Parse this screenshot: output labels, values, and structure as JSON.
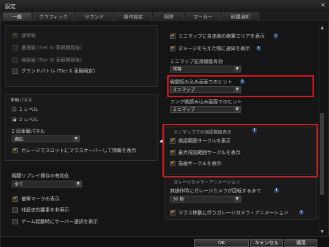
{
  "window": {
    "title": "設定",
    "close_icon": "×"
  },
  "tabs": [
    {
      "label": "一般"
    },
    {
      "label": "グラフィック"
    },
    {
      "label": "サウンド"
    },
    {
      "label": "操作設定"
    },
    {
      "label": "照準"
    },
    {
      "label": "マーカー"
    },
    {
      "label": "戦闘通知"
    }
  ],
  "left": {
    "battle_modes": [
      {
        "label": "通常戦",
        "checked": true,
        "disabled": true
      },
      {
        "label": "遭遇戦 (Tier IV 車輌開発後)",
        "checked": false,
        "disabled": true
      },
      {
        "label": "強襲戦 (Tier VI 車輌開発後)",
        "checked": false,
        "disabled": true
      },
      {
        "label": "グランドバトル (Tier X 車輌限定)",
        "checked": false,
        "disabled": false
      }
    ],
    "vehicle_panel": {
      "header": "車輌パネル",
      "radio1": "1 レベル",
      "radio2": "2 レベル",
      "two_level_label": "2 段車輌パネル",
      "two_level_value": "適応",
      "garage_slot": "ガレージでスロットにマウスオーバーして情報を表示"
    },
    "replay": {
      "label": "戦闘リプレイ保存の有効化",
      "value": "全て"
    },
    "misc": [
      {
        "label": "優等マークの表示",
        "checked": true
      },
      {
        "label": "非歴史的要素を非表示",
        "checked": false
      },
      {
        "label": "ゲーム起動時にサーバー選択を表示",
        "checked": false
      }
    ]
  },
  "right": {
    "minimap_area": "ミニマップに自走砲の砲撃エリアを表示",
    "damage_notify": "ダメージを与えた際に通知を表示",
    "minimap_zoom_label": "ミニマップ拡張機能有効",
    "minimap_zoom_value": "常時",
    "hint_label": "戦闘読み込み画面でのヒント",
    "hint_value": "ミニマップ",
    "rank_hint_label": "ランク戦読み込み画面でのヒント",
    "rank_hint_value": "ミニマップ",
    "view_range_header": "ミニマップでの視認範囲表示",
    "view_range_items": [
      {
        "label": "視認範囲サークルを表示",
        "checked": true
      },
      {
        "label": "最大視認範囲サークルを表示",
        "checked": true
      },
      {
        "label": "描画サークルを表示",
        "checked": true
      }
    ],
    "garage_cam_header": "ガレージカメラ・アニメーション",
    "garage_cam_label": "無操作時にガレージカメラが回転するまで",
    "garage_cam_value": "30 秒",
    "mouse_anim": "マウス移動に伴うガレージカメラ・アニメーション"
  },
  "buttons": {
    "ok": "OK",
    "cancel": "キャンセル",
    "apply": "適用"
  },
  "colors": {
    "accent": "#e8a020",
    "highlight": "#e0141e",
    "info": "#2c4f7a"
  }
}
